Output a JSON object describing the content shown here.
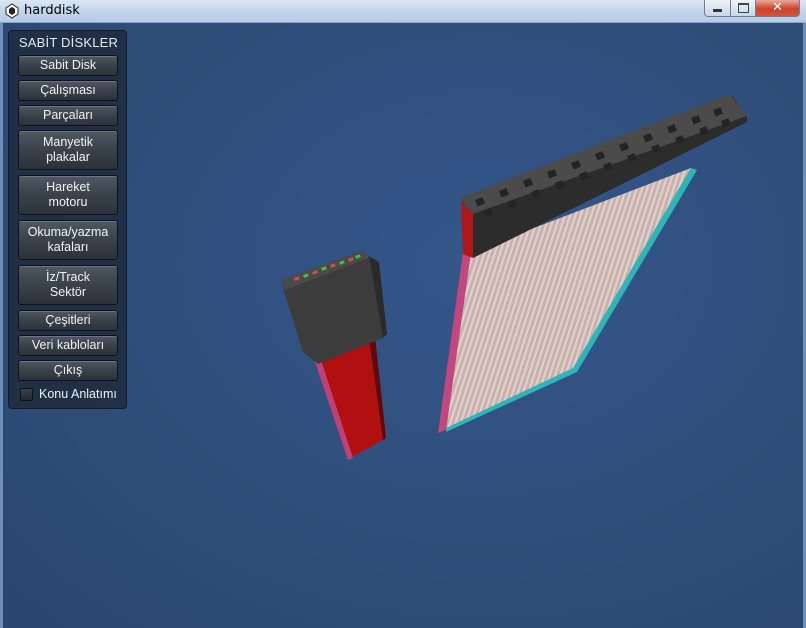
{
  "window": {
    "title": "harddisk",
    "icon": "unity-icon",
    "controls": [
      "minimize-icon",
      "maximize-icon",
      "close-icon"
    ]
  },
  "menu": {
    "title": "SABİT DİSKLER",
    "buttons": [
      "Sabit Disk",
      "Çalışması",
      "Parçaları",
      "Manyetik\nplakalar",
      "Hareket\nmotoru",
      "Okuma/yazma\nkafaları",
      "İz/Track\nSektör",
      "Çeşitleri",
      "Veri kabloları",
      "Çıkış"
    ],
    "toggle": {
      "label": "Konu Anlatımı",
      "checked": false
    }
  },
  "scene": {
    "background_color": "#2f4e7a",
    "objects": [
      "sata-cable-connector",
      "ide-ribbon-cable-connector"
    ]
  }
}
